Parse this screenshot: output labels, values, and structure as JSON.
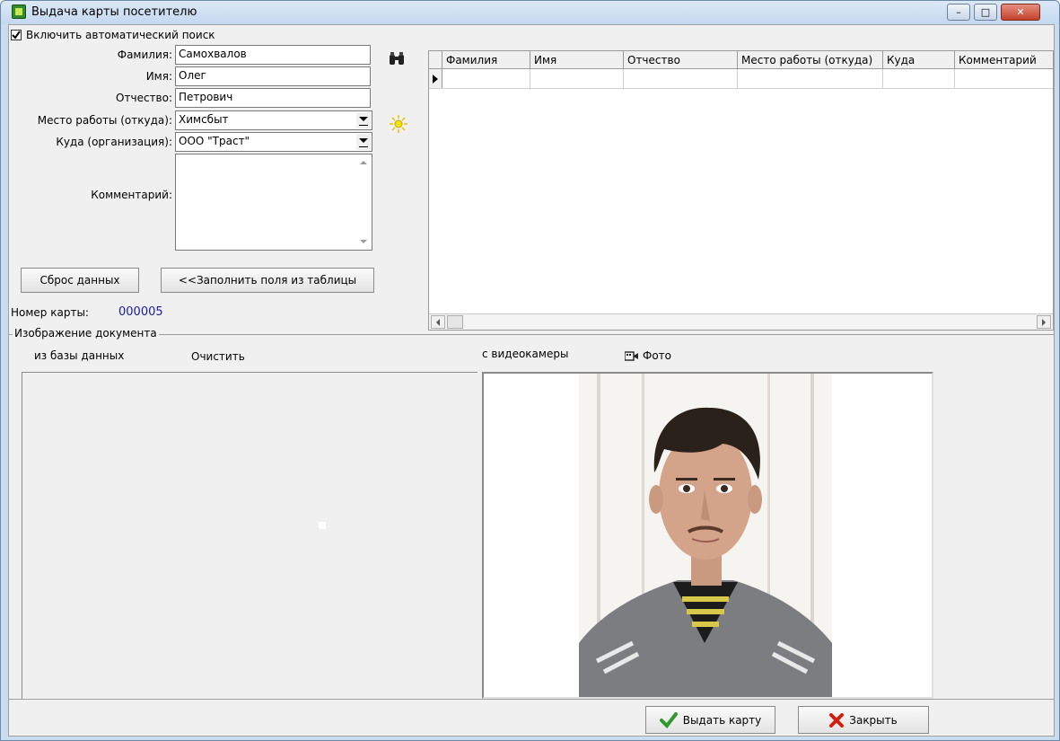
{
  "window": {
    "title": "Выдача карты посетителю",
    "minimize": "–",
    "maximize": "□",
    "close": "✕"
  },
  "search": {
    "auto_search_checked": true,
    "auto_search_label": "Включить автоматический поиск"
  },
  "form": {
    "last_name_label": "Фамилия:",
    "last_name_value": "Самохвалов",
    "first_name_label": "Имя:",
    "first_name_value": "Олег",
    "patronymic_label": "Отчество:",
    "patronymic_value": "Петрович",
    "workplace_label": "Место работы (откуда):",
    "workplace_value": "Химсбыт",
    "destination_label": "Куда (организация):",
    "destination_value": "ООО \"Траст\"",
    "comment_label": "Комментарий:",
    "comment_value": ""
  },
  "buttons": {
    "reset": "Сброс данных",
    "fill_from_table": "<<Заполнить поля из таблицы",
    "issue_card": "Выдать карту",
    "close": "Закрыть"
  },
  "card": {
    "label": "Номер карты:",
    "number": "000005"
  },
  "table": {
    "columns": [
      "Фамилия",
      "Имя",
      "Отчество",
      "Место работы (откуда)",
      "Куда",
      "Комментарий"
    ],
    "rows": [
      [
        "",
        "",
        "",
        "",
        "",
        ""
      ]
    ]
  },
  "document": {
    "group_label": "Изображение документа",
    "from_db": "из базы данных",
    "clear": "Очистить",
    "from_camera": "с видеокамеры",
    "photo": "Фото"
  },
  "colors": {
    "card_number": "#1a1aa6",
    "issue_icon": "#2e9a2e",
    "close_icon": "#d02010"
  }
}
